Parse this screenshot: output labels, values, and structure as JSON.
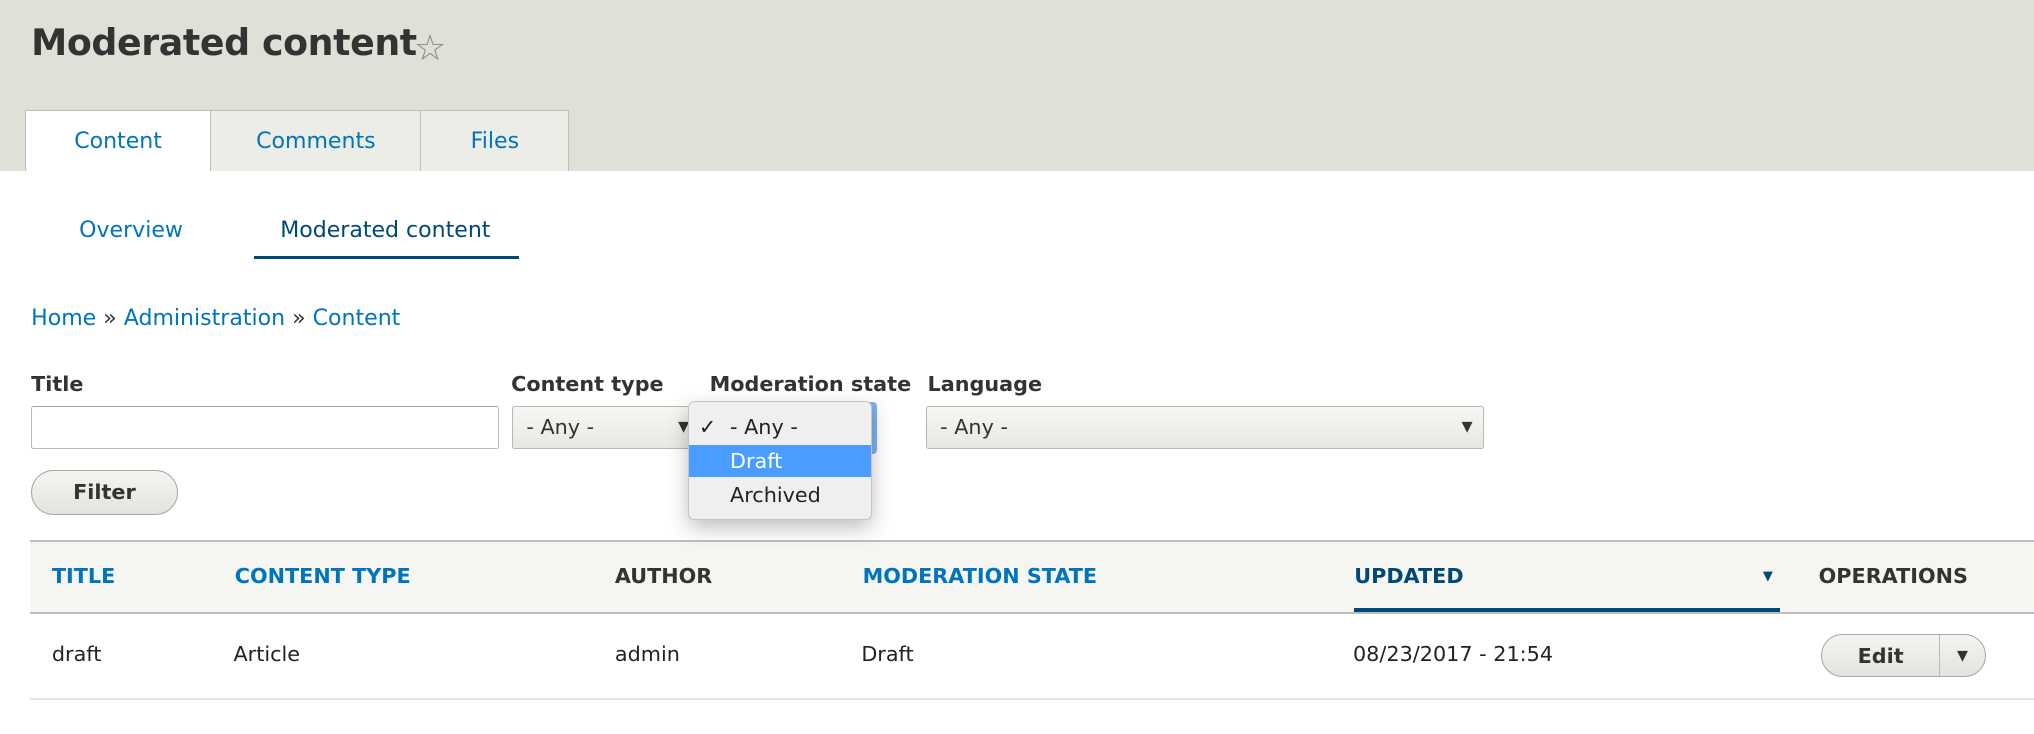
{
  "page": {
    "title": "Moderated content",
    "star_icon": "star-outline-icon"
  },
  "primary_tabs": [
    {
      "label": "Content",
      "active": true
    },
    {
      "label": "Comments"
    },
    {
      "label": "Files"
    }
  ],
  "secondary_tabs": [
    {
      "label": "Overview"
    },
    {
      "label": "Moderated content",
      "active": true
    }
  ],
  "breadcrumb": {
    "items": [
      "Home",
      "Administration",
      "Content"
    ],
    "separator": "»"
  },
  "filters": {
    "title": {
      "label": "Title",
      "value": ""
    },
    "content_type": {
      "label": "Content type",
      "value": "- Any -"
    },
    "moderation_state": {
      "label": "Moderation state",
      "options": [
        "- Any -",
        "Draft",
        "Archived"
      ],
      "selected": "- Any -",
      "highlighted": "Draft",
      "check": "✓"
    },
    "language": {
      "label": "Language",
      "value": "- Any -"
    },
    "filter_button": "Filter"
  },
  "table": {
    "headers": [
      "TITLE",
      "CONTENT TYPE",
      "AUTHOR",
      "MODERATION STATE",
      "UPDATED",
      "OPERATIONS"
    ],
    "sort_indicator": "▼",
    "rows": [
      {
        "title": "draft",
        "content_type": "Article",
        "author": "admin",
        "moderation_state": "Draft",
        "updated": "08/23/2017 - 21:54",
        "operation": "Edit"
      }
    ]
  },
  "colors": {
    "link": "#0074bd",
    "active": "#004875",
    "highlight": "#4a9dff",
    "header_bg": "#e0e0d8"
  }
}
